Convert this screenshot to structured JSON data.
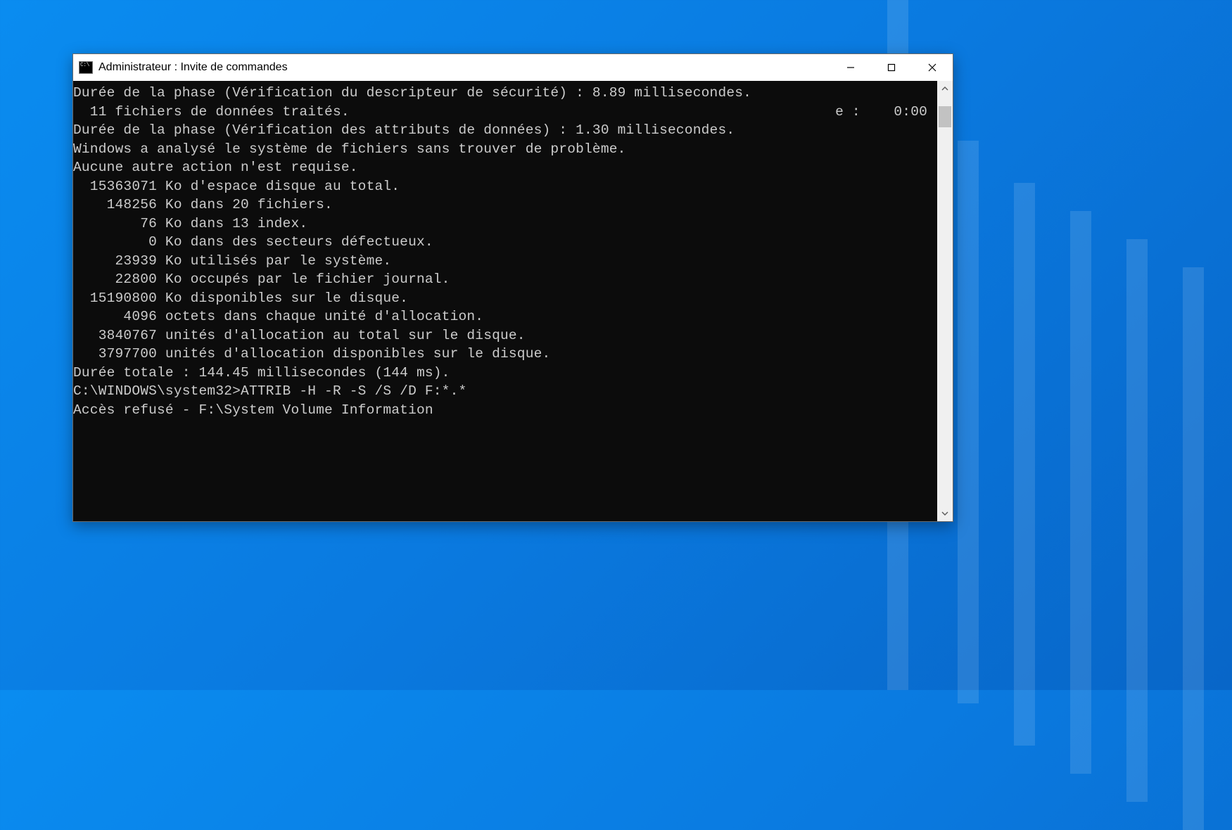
{
  "window": {
    "title": "Administrateur : Invite de commandes"
  },
  "console": {
    "time_fragment": "e :    0:00",
    "lines": [
      "Durée de la phase (Vérification du descripteur de sécurité) : 8.89 millisecondes.",
      "  11 fichiers de données traités.",
      "Durée de la phase (Vérification des attributs de données) : 1.30 millisecondes.",
      "",
      "Windows a analysé le système de fichiers sans trouver de problème.",
      "Aucune autre action n'est requise.",
      "",
      "  15363071 Ko d'espace disque au total.",
      "    148256 Ko dans 20 fichiers.",
      "        76 Ko dans 13 index.",
      "         0 Ko dans des secteurs défectueux.",
      "     23939 Ko utilisés par le système.",
      "     22800 Ko occupés par le fichier journal.",
      "  15190800 Ko disponibles sur le disque.",
      "",
      "      4096 octets dans chaque unité d'allocation.",
      "   3840767 unités d'allocation au total sur le disque.",
      "   3797700 unités d'allocation disponibles sur le disque.",
      "Durée totale : 144.45 millisecondes (144 ms).",
      "",
      "C:\\WINDOWS\\system32>ATTRIB -H -R -S /S /D F:*.*",
      "Accès refusé - F:\\System Volume Information",
      ""
    ]
  }
}
